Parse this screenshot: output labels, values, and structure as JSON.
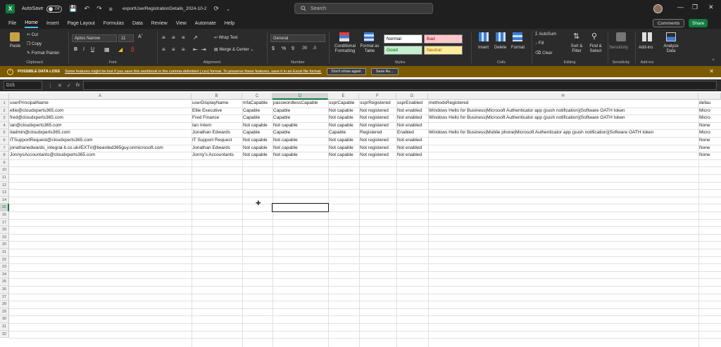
{
  "titlebar": {
    "autosave_label": "AutoSave",
    "autosave_state": "Off",
    "filename": "exportUserRegistrationDetails_2024-10-2",
    "search_placeholder": "Search"
  },
  "menubar": {
    "items": [
      "File",
      "Home",
      "Insert",
      "Page Layout",
      "Formulas",
      "Data",
      "Review",
      "View",
      "Automate",
      "Help"
    ],
    "active": "Home",
    "comments_label": "Comments",
    "share_label": "Share"
  },
  "ribbon": {
    "clipboard": {
      "paste": "Paste",
      "cut": "Cut",
      "copy": "Copy",
      "format_painter": "Format Painter",
      "label": "Clipboard"
    },
    "font": {
      "name": "Aptos Narrow",
      "size": "11",
      "label": "Font"
    },
    "alignment": {
      "wrap_text": "Wrap Text",
      "merge_center": "Merge & Center",
      "label": "Alignment"
    },
    "number": {
      "format": "General",
      "label": "Number"
    },
    "styles": {
      "conditional": "Conditional Formatting",
      "format_as_table": "Format as Table",
      "normal": "Normal",
      "bad": "Bad",
      "good": "Good",
      "neutral": "Neutral",
      "label": "Styles"
    },
    "cells": {
      "insert": "Insert",
      "delete": "Delete",
      "format": "Format",
      "label": "Cells"
    },
    "editing": {
      "autosum": "AutoSum",
      "fill": "Fill",
      "clear": "Clear",
      "sort_filter": "Sort & Filter",
      "find_select": "Find & Select",
      "label": "Editing"
    },
    "sensitivity": {
      "button": "Sensitivity",
      "label": "Sensitivity"
    },
    "addins": {
      "button": "Add-ins",
      "label": "Add-ins"
    },
    "analyze": {
      "button": "Analyze Data"
    }
  },
  "infobar": {
    "title": "POSSIBLE DATA LOSS",
    "message": "Some features might be lost if you save this workbook in the comma-delimited (.csv) format. To preserve these features, save it in an Excel file format.",
    "dont_show": "Don't show again",
    "save_as": "Save As..."
  },
  "formula": {
    "namebox": "D15",
    "fx": "fx",
    "value": ""
  },
  "sheet": {
    "columns": [
      "A",
      "B",
      "C",
      "D",
      "E",
      "F",
      "G",
      "H",
      ""
    ],
    "selected_column": "D",
    "selected_row": 15,
    "row_count": 32,
    "rows": [
      [
        "userPrincipalName",
        "userDisplayName",
        "mfaCapable",
        "passwordlessCapable",
        "ssprCapable",
        "ssprRegistered",
        "ssprEnabled",
        "methodsRegistered",
        "defau"
      ],
      [
        "ellie@cloudxperts365.com",
        "Ellie Executive",
        "Capable",
        "Capable",
        "Not capable",
        "Not registered",
        "Not enabled",
        "Windows Hello for Business|Microsoft Authenticator app (push notification)|Software OATH token",
        "Micro"
      ],
      [
        "fred@cloudxperts365.com",
        "Fred Finance",
        "Capable",
        "Capable",
        "Not capable",
        "Not registered",
        "Not enabled",
        "Windows Hello for Business|Microsoft Authenticator app (push notification)|Software OATH token",
        "Micro"
      ],
      [
        "ian@cloudxperts365.com",
        "Ian Intern",
        "Not capable",
        "Not capable",
        "Not capable",
        "Not registered",
        "Not enabled",
        "",
        "None"
      ],
      [
        "itadmin@cloudxperts365.com",
        "Jonathan Edwards",
        "Capable",
        "Capable",
        "Capable",
        "Registered",
        "Enabled",
        "Windows Hello for Business|Mobile phone|Microsoft Authenticator app (push notification)|Software OATH token",
        "Micro"
      ],
      [
        "ITSupportRequest@cloudxperts365.com",
        "IT Support Request",
        "Not capable",
        "Not capable",
        "Not capable",
        "Not registered",
        "Not enabled",
        "",
        "None"
      ],
      [
        "jonathanedwards_integral-it.co.uk#EXT#@bearded365guy.onmicrosoft.com",
        "Jonathan Edwards",
        "Not capable",
        "Not capable",
        "Not capable",
        "Not registered",
        "Not enabled",
        "",
        "None"
      ],
      [
        "JonnysAccountants@cloudxperts365.com",
        "Jonny's Accountants",
        "Not capable",
        "Not capable",
        "Not capable",
        "Not registered",
        "Not enabled",
        "",
        "None"
      ]
    ]
  }
}
